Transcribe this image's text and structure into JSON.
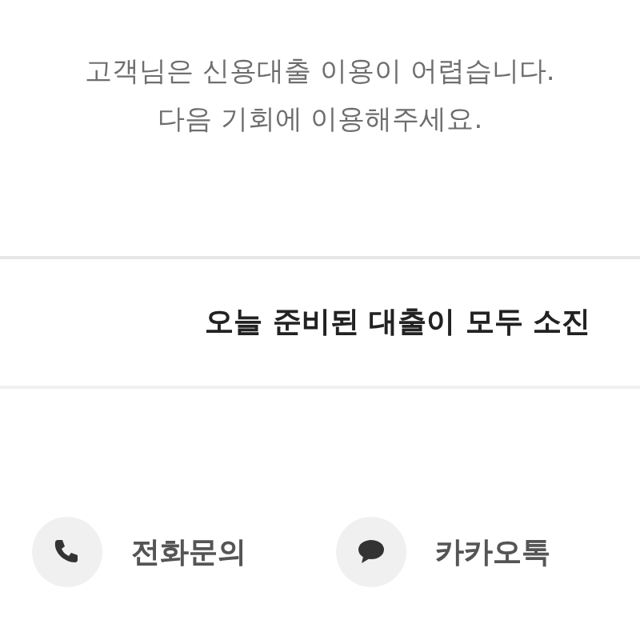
{
  "message": {
    "lines": [
      "고객님은 신용대출 이용이 어렵습니다.",
      "다음 기회에 이용해주세요."
    ]
  },
  "banner": {
    "text": "오늘 준비된 대출이 모두 소진"
  },
  "contacts": [
    {
      "kind": "phone",
      "label": "전화문의"
    },
    {
      "kind": "chat",
      "label": "카카오톡"
    }
  ]
}
